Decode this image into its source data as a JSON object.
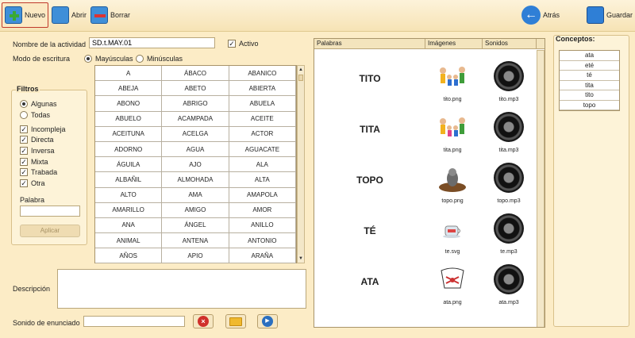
{
  "toolbar": {
    "new_label": "Nuevo",
    "open_label": "Abrir",
    "delete_label": "Borrar",
    "back_label": "Atrás",
    "save_label": "Guardar"
  },
  "form": {
    "activity_name_label": "Nombre de la actividad",
    "activity_name_value": "SD.t.MAY.01",
    "active_label": "Activo",
    "write_mode_label": "Modo de escritura",
    "uppercase_label": "Mayúsculas",
    "lowercase_label": "Minúsculas",
    "description_label": "Descripción",
    "description_value": "",
    "statement_sound_label": "Sonido de enunciado",
    "statement_sound_value": ""
  },
  "filters": {
    "title": "Filtros",
    "some_label": "Algunas",
    "all_label": "Todas",
    "checks": [
      "Incompleja",
      "Directa",
      "Inversa",
      "Mixta",
      "Trabada",
      "Otra"
    ],
    "word_label": "Palabra",
    "word_value": "",
    "apply_label": "Aplicar"
  },
  "words_grid": [
    "A",
    "ÁBACO",
    "ABANICO",
    "ABEJA",
    "ABETO",
    "ABIERTA",
    "ABONO",
    "ABRIGO",
    "ABUELA",
    "ABUELO",
    "ACAMPADA",
    "ACEITE",
    "ACEITUNA",
    "ACELGA",
    "ACTOR",
    "ADORNO",
    "AGUA",
    "AGUACATE",
    "ÁGUILA",
    "AJO",
    "ALA",
    "ALBAÑIL",
    "ALMOHADA",
    "ALTA",
    "ALTO",
    "AMA",
    "AMAPOLA",
    "AMARILLO",
    "AMIGO",
    "AMOR",
    "ANA",
    "ÁNGEL",
    "ANILLO",
    "ANIMAL",
    "ANTENA",
    "ANTONIO",
    "AÑOS",
    "APIO",
    "ARAÑA"
  ],
  "table": {
    "headers": [
      "Palabras",
      "Imágenes",
      "Sonidos"
    ],
    "rows": [
      {
        "word": "TITO",
        "image": "tito.png",
        "sound": "tito.mp3"
      },
      {
        "word": "TITA",
        "image": "tita.png",
        "sound": "tita.mp3"
      },
      {
        "word": "TOPO",
        "image": "topo.png",
        "sound": "topo.mp3"
      },
      {
        "word": "TÉ",
        "image": "te.svg",
        "sound": "te.mp3"
      },
      {
        "word": "ATA",
        "image": "ata.png",
        "sound": "ata.mp3"
      }
    ]
  },
  "concepts": {
    "title": "Conceptos:",
    "items": [
      "ata",
      "eté",
      "té",
      "tita",
      "tito",
      "topo"
    ]
  }
}
